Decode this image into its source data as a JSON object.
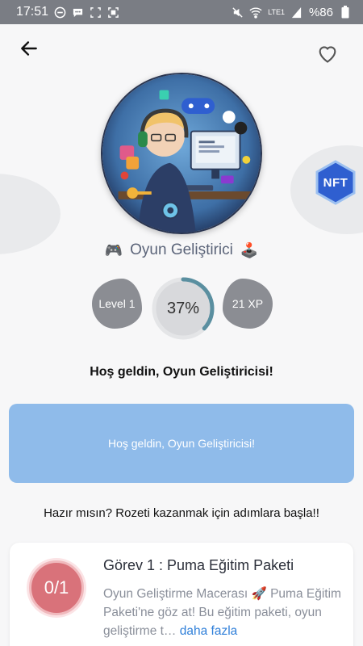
{
  "status_bar": {
    "time": "17:51",
    "battery": "%86",
    "network": "LTE1"
  },
  "header": {
    "back_icon": "arrow-left-icon",
    "favorite_icon": "heart-outline-icon"
  },
  "profile": {
    "name": "Oyun Geliştirici",
    "left_emoji": "🎮",
    "right_emoji": "🕹️",
    "nft_label": "NFT",
    "level_label": "Level 1",
    "progress_label": "37%",
    "progress_value": 0.37,
    "xp_label": "21 XP"
  },
  "welcome": {
    "heading": "Hoş geldin, Oyun Geliştiricisi!",
    "card_text": "Hoş geldin, Oyun Geliştiricisi!"
  },
  "prompt": "Hazır mısın? Rozeti kazanmak için adımlara başla!!",
  "tasks": [
    {
      "progress": "0/1",
      "title": "Görev 1 : Puma Eğitim Paketi",
      "description": "Oyun Geliştirme Macerası 🚀 Puma Eğitim Paketi'ne göz at! Bu eğitim paketi, oyun geliştirme t…",
      "more_label": "daha fazla"
    }
  ],
  "colors": {
    "accent_blue": "#8fbbea",
    "stat_gray": "#8b8d93",
    "progress_teal": "#5a8fa0",
    "task_red": "#d9727a",
    "link_blue": "#2f7fd9",
    "nft_blue": "#2f5fd0"
  }
}
